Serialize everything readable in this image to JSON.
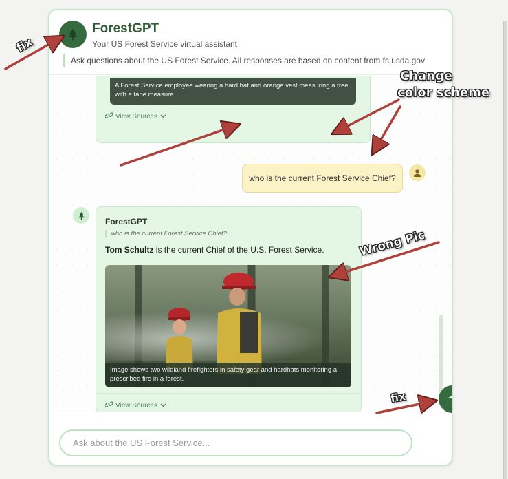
{
  "app": {
    "title": "ForestGPT",
    "subtitle": "Your US Forest Service virtual assistant",
    "notice": "Ask questions about the US Forest Service. All responses are based on content from fs.usda.gov"
  },
  "messages": {
    "prev_bot": {
      "image_caption": "A Forest Service employee wearing a hard hat and orange vest measuring a tree with a tape measure",
      "view_sources": "View Sources"
    },
    "user": {
      "text": "who is the current Forest Service Chief?"
    },
    "bot": {
      "name": "ForestGPT",
      "quoted_question": "who is the current Forest Service Chief?",
      "answer_bold": "Tom Schultz",
      "answer_rest": " is the current Chief of the U.S. Forest Service.",
      "image_caption": "Image shows two wildland firefighters in safety gear and hardhats monitoring a prescribed fire in a forest.",
      "view_sources": "View Sources"
    }
  },
  "input": {
    "placeholder": "Ask about the US Forest Service..."
  },
  "annotations": {
    "fix_top": "fix",
    "change_color_line1": "Change",
    "change_color_line2": "color scheme",
    "wrong_pic": "Wrong Pic",
    "fix_bottom": "fix"
  },
  "colors": {
    "brand_green": "#356b3e",
    "bot_bubble": "#e4f6e4",
    "user_bubble": "#fbf2c6",
    "arrow": "#b0403a"
  },
  "icons": {
    "logo": "tree-icon",
    "user_avatar": "user-icon",
    "bot_avatar": "tree-icon",
    "sources": "link-icon",
    "send": "send-icon"
  }
}
